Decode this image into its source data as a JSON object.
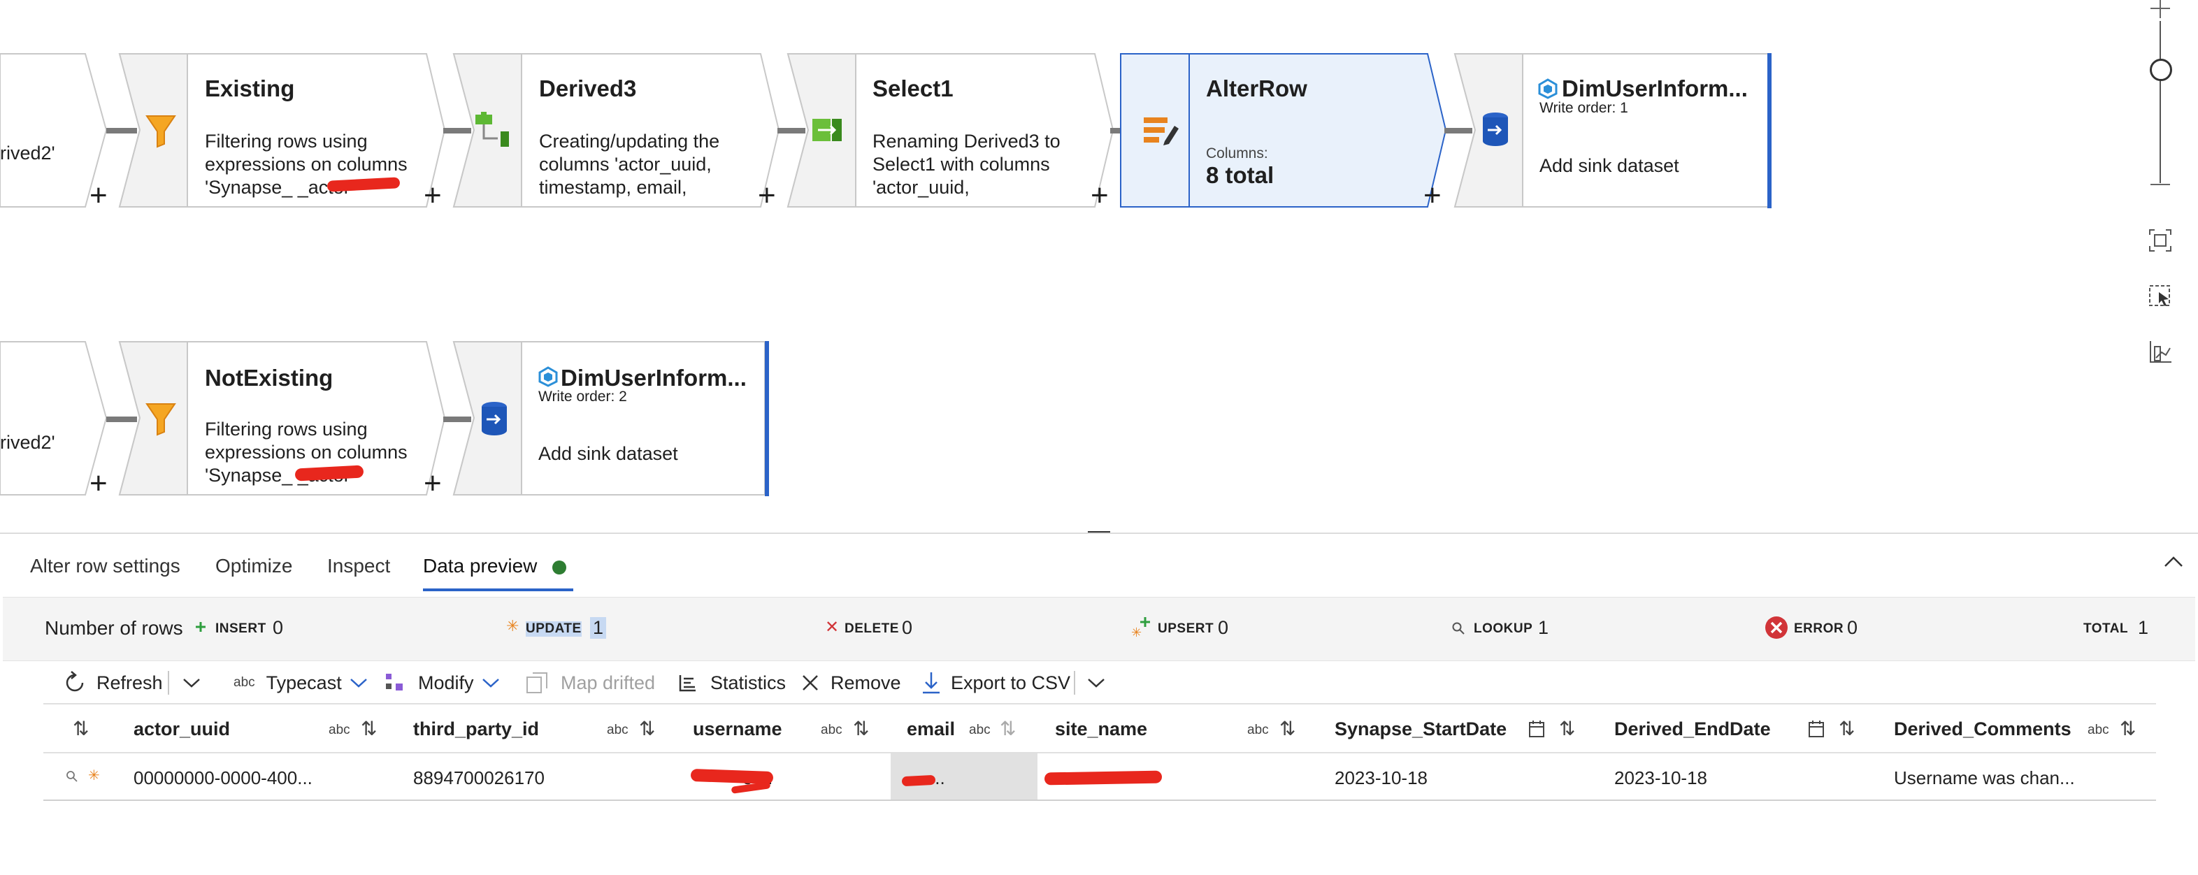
{
  "canvas": {
    "row1": {
      "partial_node_text": "rived2'",
      "nodes": [
        {
          "title": "Existing",
          "desc": "Filtering rows using\nexpressions on columns\n'Synapse_          _actor\n_UUID'..."
        },
        {
          "title": "Derived3",
          "desc": "Creating/updating the\ncolumns 'actor_uuid,\ntimestamp, email,\nsite..."
        },
        {
          "title": "Select1",
          "desc": "Renaming Derived3 to\nSelect1 with columns\n'actor_uuid,\nthird_party_id..."
        },
        {
          "title": "AlterRow",
          "columns_label": "Columns:",
          "columns_value": "8 total"
        },
        {
          "title": "DimUserInform...",
          "write_order": "Write order: 1",
          "desc": "Add sink dataset"
        }
      ]
    },
    "row2": {
      "partial_node_text": "rived2'",
      "nodes": [
        {
          "title": "NotExisting",
          "desc": "Filtering rows using\nexpressions on columns\n'Synapse_          _actor\n_UUID'..."
        },
        {
          "title": "DimUserInform...",
          "write_order": "Write order: 2",
          "desc": "Add sink dataset"
        }
      ]
    },
    "plus": "+",
    "zoom_tools": [
      "plus-icon",
      "zoom-slider",
      "minus-icon",
      "fit-to-view-icon",
      "select-icon",
      "chart-icon"
    ]
  },
  "panel": {
    "tabs": [
      "Alter row settings",
      "Optimize",
      "Inspect",
      "Data preview"
    ],
    "active_tab": "Data preview",
    "status_color": "#2e7d32",
    "stats": {
      "title": "Number of rows",
      "insert_label": "INSERT",
      "insert_value": "0",
      "update_label": "UPDATE",
      "update_value": "1",
      "delete_label": "DELETE",
      "delete_value": "0",
      "upsert_label": "UPSERT",
      "upsert_value": "0",
      "lookup_label": "LOOKUP",
      "lookup_value": "1",
      "error_label": "ERROR",
      "error_value": "0",
      "total_label": "TOTAL",
      "total_value": "1"
    },
    "toolbar": {
      "refresh": "Refresh",
      "typecast": "Typecast",
      "typecast_prefix": "abc",
      "modify": "Modify",
      "map_drifted": "Map drifted",
      "statistics": "Statistics",
      "remove": "Remove",
      "export": "Export to CSV"
    },
    "table": {
      "columns": [
        "actor_uuid",
        "third_party_id",
        "username",
        "email",
        "site_name",
        "Synapse_StartDate",
        "Derived_EndDate",
        "Derived_Comments"
      ],
      "abc": "abc",
      "row": {
        "actor_uuid": "00000000-0000-400...",
        "third_party_id": "8894700026170",
        "username": "e ...",
        "email": "...",
        "site_name": "",
        "Synapse_StartDate": "2023-10-18",
        "Derived_EndDate": "2023-10-18",
        "Derived_Comments": "Username was chan..."
      }
    }
  },
  "colors": {
    "accent_blue": "#2b63c8",
    "selected_fill": "#e9f1fb",
    "redaction": "#e8271d",
    "error_red": "#d13438",
    "insert_green": "#2e9e3e",
    "update_orange": "#e8831e"
  }
}
